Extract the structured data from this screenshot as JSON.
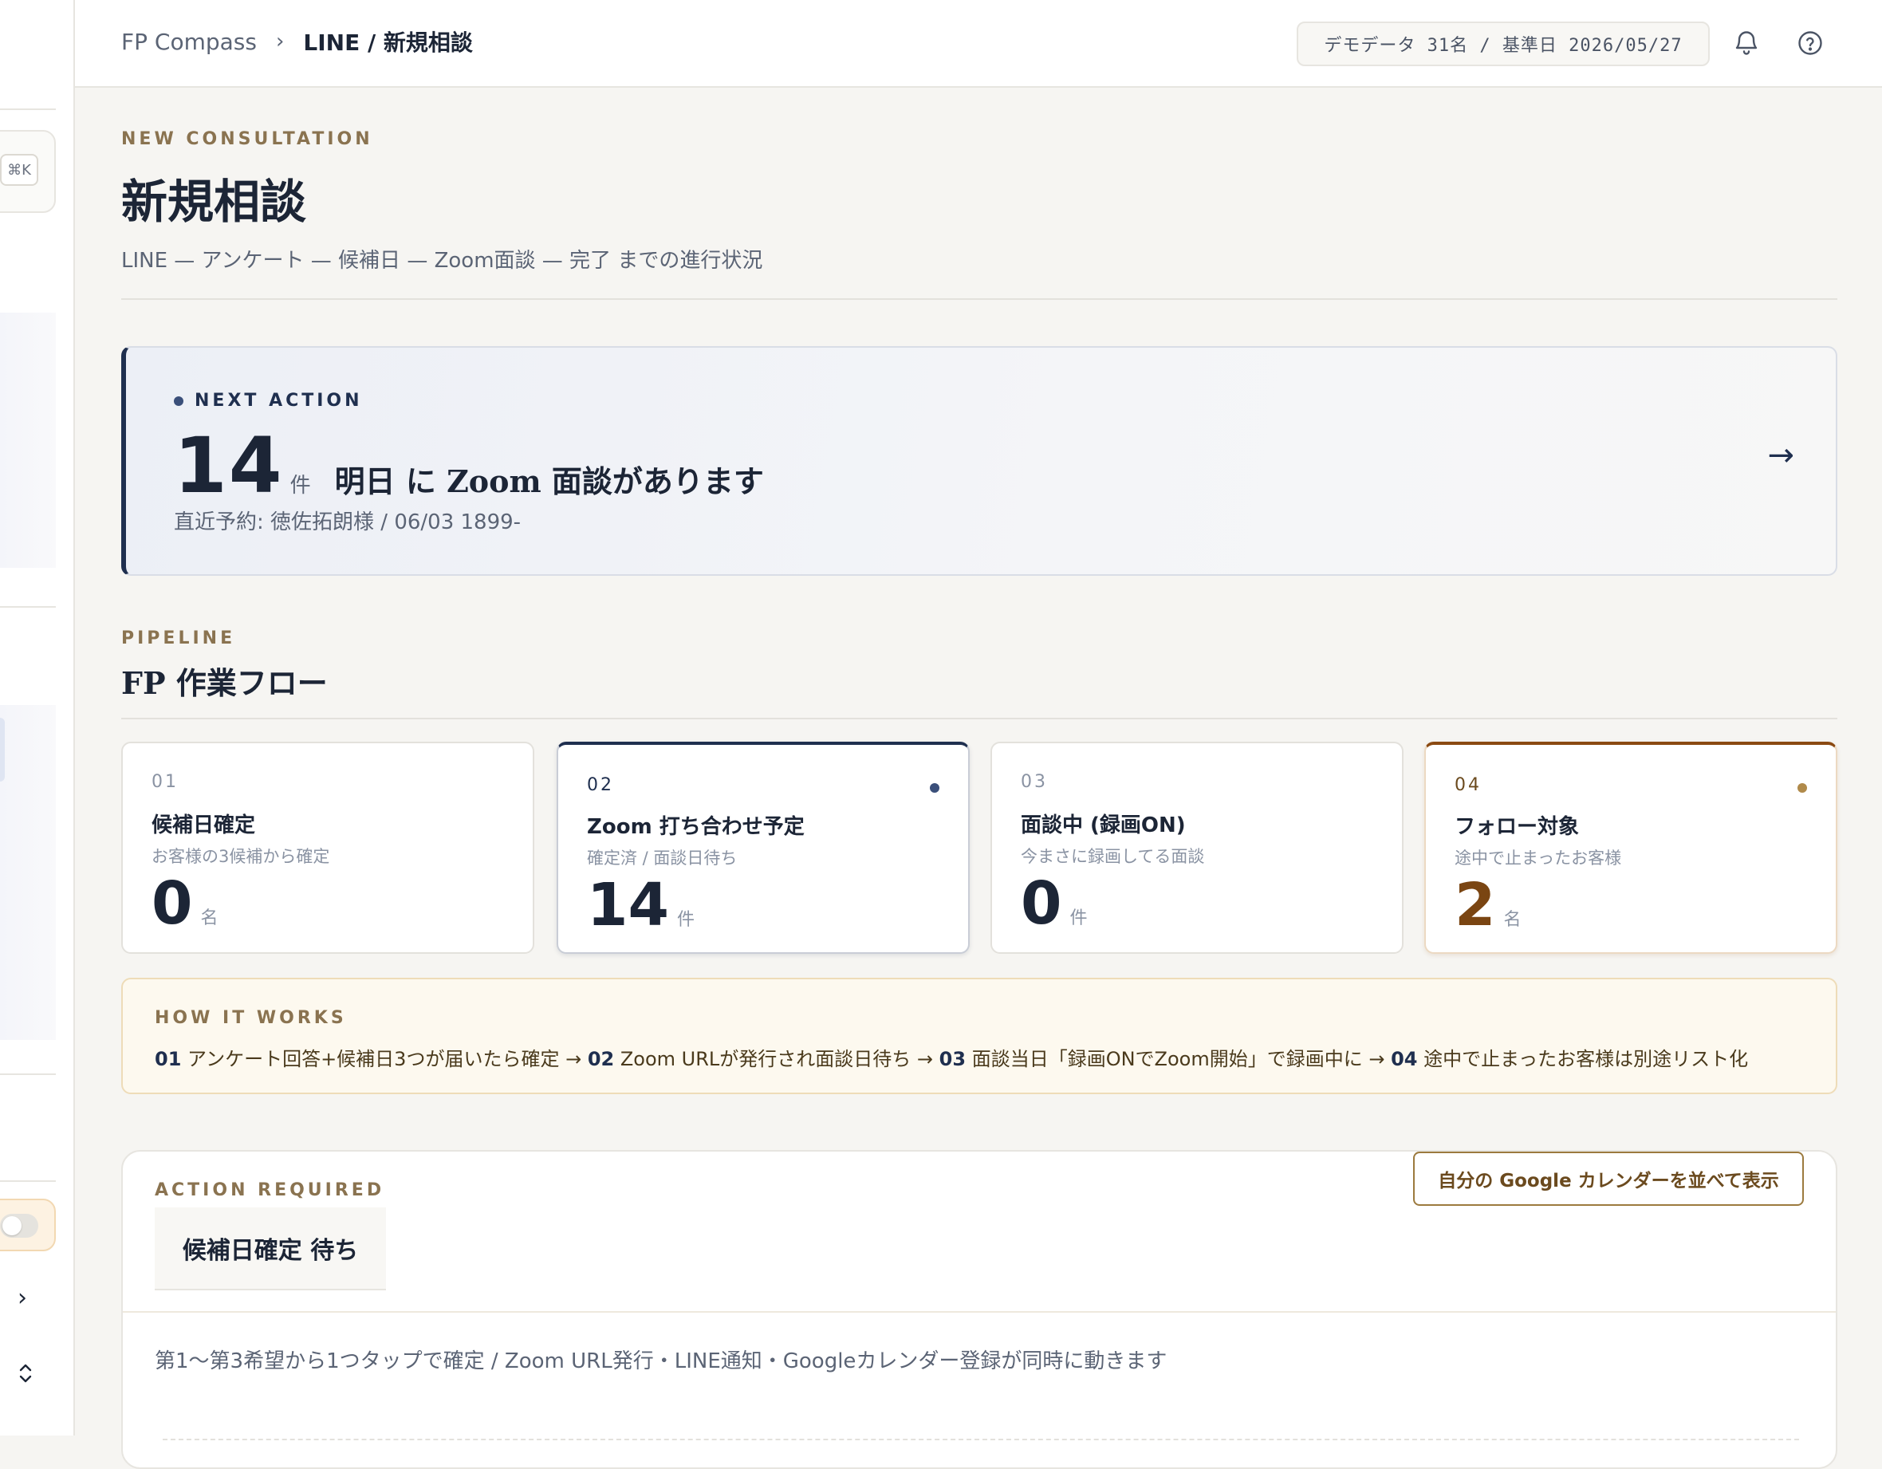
{
  "sidebar": {
    "shortcut": "⌘K"
  },
  "header": {
    "breadcrumb_root": "FP Compass",
    "breadcrumb_sep": "›",
    "breadcrumb_current": "LINE / 新規相談",
    "demo_chip": "デモデータ 31名 / 基準日 2026/05/27",
    "icons": [
      "bell-icon",
      "help-icon"
    ]
  },
  "page": {
    "eyebrow": "NEW CONSULTATION",
    "title": "新規相談",
    "subtitle": "LINE — アンケート — 候補日 — Zoom面談 — 完了 までの進行状況"
  },
  "next_action": {
    "label": "NEXT ACTION",
    "count": "14",
    "unit": "件",
    "text": "明日 に Zoom 面談があります",
    "sub": "直近予約: 徳佐拓朗様 / 06/03 1899-",
    "arrow": "→"
  },
  "pipeline": {
    "eyebrow": "PIPELINE",
    "title": "FP 作業フロー",
    "stages": [
      {
        "num": "01",
        "title": "候補日確定",
        "desc": "お客様の3候補から確定",
        "value": "0",
        "unit": "名"
      },
      {
        "num": "02",
        "title": "Zoom 打ち合わせ予定",
        "desc": "確定済 / 面談日待ち",
        "value": "14",
        "unit": "件"
      },
      {
        "num": "03",
        "title": "面談中 (録画ON)",
        "desc": "今まさに録画してる面談",
        "value": "0",
        "unit": "件"
      },
      {
        "num": "04",
        "title": "フォロー対象",
        "desc": "途中で止まったお客様",
        "value": "2",
        "unit": "名"
      }
    ],
    "colors": {
      "active": "#1f2f4f",
      "follow": "#8b4a12",
      "dot_active": "#3a4f7a",
      "dot_follow": "#b08a4a"
    }
  },
  "how_it_works": {
    "label": "HOW IT WORKS",
    "steps": [
      {
        "num": "01",
        "text": " アンケート回答+候補日3つが届いたら確定 → "
      },
      {
        "num": "02",
        "text": " Zoom URLが発行され面談日待ち → "
      },
      {
        "num": "03",
        "text": " 面談当日「録画ONでZoom開始」で録画中に → "
      },
      {
        "num": "04",
        "text": " 途中で止まったお客様は別途リスト化"
      }
    ]
  },
  "action_required": {
    "label": "ACTION REQUIRED",
    "tab": "候補日確定 待ち",
    "gcal_button": "自分の Google カレンダーを並べて表示",
    "note": "第1〜第3希望から1つタップで確定 / Zoom URL発行・LINE通知・Googleカレンダー登録が同時に動きます"
  }
}
